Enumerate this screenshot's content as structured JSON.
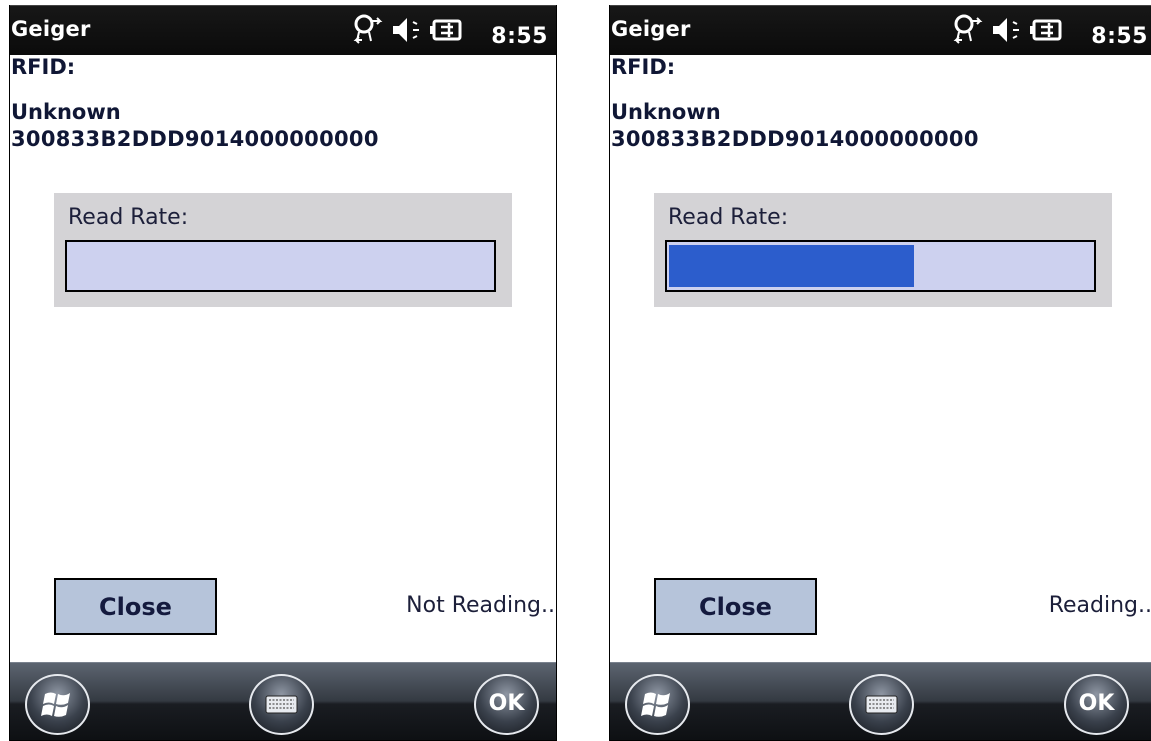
{
  "screens": [
    {
      "app_title": "Geiger",
      "clock": "8:55",
      "rfid_label": "RFID:",
      "tag_name": "Unknown",
      "tag_id": "300833B2DDD9014000000000",
      "read_rate_label": "Read Rate:",
      "read_rate_fraction": 0.0,
      "close_label": "Close",
      "status": "Not Reading...",
      "ok_label": "OK",
      "status_icons": [
        "connectivity-icon",
        "speaker-icon",
        "battery-charging-icon"
      ],
      "softkeys": [
        "windows-start-icon",
        "keyboard-icon",
        "ok-icon"
      ]
    },
    {
      "app_title": "Geiger",
      "clock": "8:55",
      "rfid_label": "RFID:",
      "tag_name": "Unknown",
      "tag_id": "300833B2DDD9014000000000",
      "read_rate_label": "Read Rate:",
      "read_rate_fraction": 0.58,
      "close_label": "Close",
      "status": "Reading...",
      "ok_label": "OK",
      "status_icons": [
        "connectivity-icon",
        "speaker-icon",
        "battery-charging-icon"
      ],
      "softkeys": [
        "windows-start-icon",
        "keyboard-icon",
        "ok-icon"
      ]
    }
  ],
  "colors": {
    "title_bar": "#0f0f0f",
    "text_dark": "#101735",
    "panel": "#d4d3d6",
    "bar_empty": "#cdd1ef",
    "bar_fill": "#2c5dcc",
    "button": "#b6c4da"
  }
}
